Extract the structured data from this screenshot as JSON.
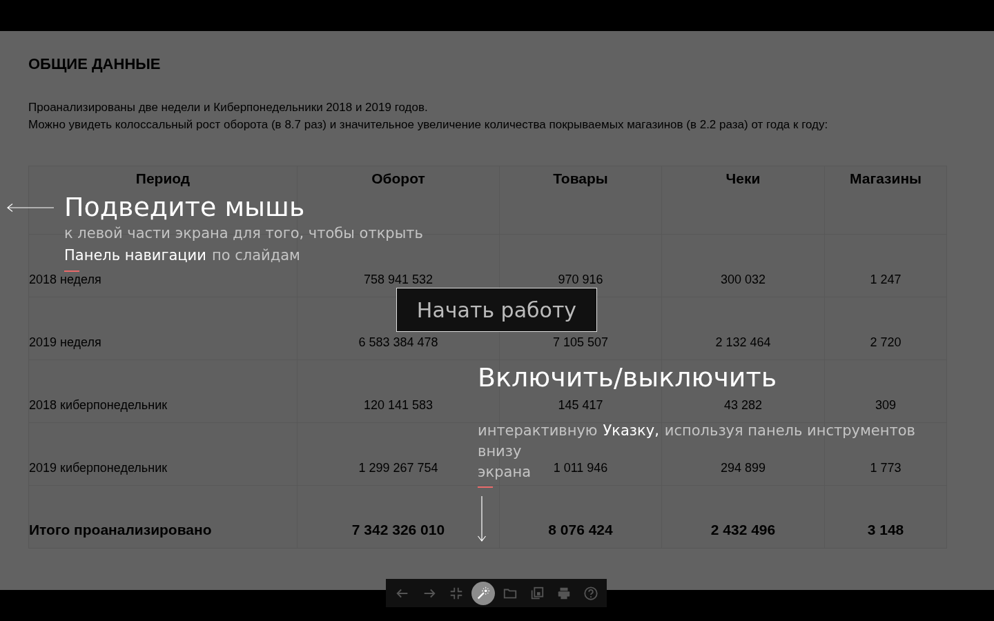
{
  "slide": {
    "title": "ОБЩИЕ ДАННЫЕ",
    "paragraph_lines": [
      "Проанализированы две недели и Киберпонедельники 2018 и 2019 годов.",
      "Можно увидеть колоссальный рост оборота (в 8.7 раз) и значительное увеличение количества покрываемых магазинов (в 2.2 раза) от года к году:"
    ],
    "table": {
      "columns": [
        "Период",
        "Оборот",
        "Товары",
        "Чеки",
        "Магазины"
      ],
      "rows": [
        {
          "kind": "data",
          "cells": [
            "2018 неделя",
            "758 941 532",
            "970 916",
            "300 032",
            "1 247"
          ]
        },
        {
          "kind": "data",
          "cells": [
            "2019 неделя",
            "6 583 384 478",
            "7 105 507",
            "2 132 464",
            "2 720"
          ]
        },
        {
          "kind": "data",
          "cells": [
            "2018 киберпонедельник",
            "120 141 583",
            "145 417",
            "43 282",
            "309"
          ]
        },
        {
          "kind": "data",
          "cells": [
            "2019 киберпонедельник",
            "1 299 267 754",
            "1 011 946",
            "294 899",
            "1 773"
          ]
        },
        {
          "kind": "total",
          "cells": [
            "Итого проанализировано",
            "7 342 326 010",
            "8 076 424",
            "2 432 496",
            "3 148"
          ]
        }
      ]
    }
  },
  "hints": [
    {
      "kind": "left",
      "title": "Подведите мышь",
      "lines": [
        [
          {
            "text": "к левой части экрана для того, чтобы открыть",
            "highlight": false
          }
        ],
        [
          {
            "text": "Панель навигации",
            "highlight": true
          },
          {
            "text": "по слайдам",
            "highlight": false
          }
        ]
      ]
    },
    {
      "kind": "down",
      "title": "Включить/выключить",
      "lines": [
        [
          {
            "text": "интерактивную",
            "highlight": false
          },
          {
            "text": "Указку,",
            "highlight": true
          },
          {
            "text": "используя панель инструментов",
            "highlight": false
          }
        ],
        [
          {
            "text": "внизу",
            "highlight": false
          }
        ],
        [
          {
            "text": "экрана",
            "highlight": false
          }
        ]
      ]
    }
  ],
  "start_button": "Начать работу",
  "toolbar": [
    {
      "kind": "prev",
      "selected": false
    },
    {
      "kind": "next",
      "selected": false
    },
    {
      "kind": "collapse",
      "selected": false
    },
    {
      "kind": "pointer",
      "selected": true
    },
    {
      "kind": "folder",
      "selected": false
    },
    {
      "kind": "copy",
      "selected": false
    },
    {
      "kind": "print",
      "selected": false
    },
    {
      "kind": "help",
      "selected": false
    }
  ]
}
